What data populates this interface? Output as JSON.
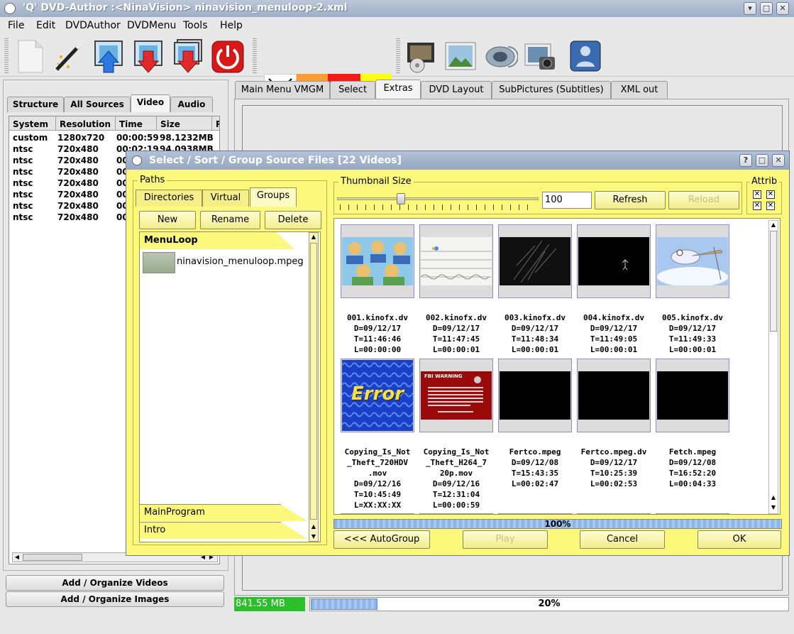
{
  "window": {
    "title": "'Q' DVD-Author :<NinaVision> ninavision_menuloop-2.xml"
  },
  "menu": [
    "File",
    "Edit",
    "DVDAuthor",
    "DVDMenu",
    "Tools",
    "Help"
  ],
  "toolbar_icons": [
    "new-document-icon",
    "magic-wand-icon",
    "import-icon",
    "export-icon",
    "export-all-icon",
    "power-icon",
    "no-color-icon",
    "orange-color",
    "red-color",
    "yellow-color",
    "video-film-icon",
    "image-icon",
    "audio-speaker-icon",
    "camera-icon",
    "user-folder-icon"
  ],
  "colors": {
    "orange": "#fb9d35",
    "red": "#f11a1a",
    "yellow": "#fdfd12",
    "dialog_bg": "#fbf87c",
    "size_green": "#2bc02b"
  },
  "left": {
    "tabs": [
      "Structure",
      "All Sources",
      "Video",
      "Audio"
    ],
    "active_tab": "Video",
    "columns": [
      "System",
      "Resolution",
      "Time",
      "Size",
      "R"
    ],
    "rows": [
      {
        "system": "custom",
        "resolution": "1280x720",
        "time": "00:00:59",
        "size": "98.1232MB"
      },
      {
        "system": "ntsc",
        "resolution": "720x480",
        "time": "00:02:19",
        "size": "94.0938MB"
      },
      {
        "system": "ntsc",
        "resolution": "720x480",
        "time": "00",
        "size": ""
      },
      {
        "system": "ntsc",
        "resolution": "720x480",
        "time": "00",
        "size": ""
      },
      {
        "system": "ntsc",
        "resolution": "720x480",
        "time": "00",
        "size": ""
      },
      {
        "system": "ntsc",
        "resolution": "720x480",
        "time": "00",
        "size": ""
      },
      {
        "system": "ntsc",
        "resolution": "720x480",
        "time": "00",
        "size": ""
      },
      {
        "system": "ntsc",
        "resolution": "720x480",
        "time": "00",
        "size": ""
      }
    ],
    "add_videos": "Add / Organize Videos",
    "add_images": "Add / Organize Images"
  },
  "main_tabs": [
    "Main Menu VMGM",
    "Select",
    "Extras",
    "DVD Layout",
    "SubPictures (Subtitles)",
    "XML out"
  ],
  "main_active_tab": "Extras",
  "status": {
    "size": "841.55 MB",
    "progress_label": "20%",
    "progress": 0.2
  },
  "dialog": {
    "title": "Select / Sort / Group Source Files [22 Videos]",
    "paths_label": "Paths",
    "path_tabs": [
      "Directories",
      "Virtual",
      "Groups"
    ],
    "active_path_tab": "Groups",
    "new": "New",
    "rename": "Rename",
    "delete": "Delete",
    "group_active": "MenuLoop",
    "group_file": "ninavision_menuloop.mpeg",
    "groups_other": [
      "MainProgram",
      "Intro"
    ],
    "thumb_label": "Thumbnail Size",
    "thumb_value": "100",
    "thumb_level": 100,
    "refresh": "Refresh",
    "reload": "Reload",
    "attrib_label": "Attrib",
    "thumbnails": [
      {
        "name": "001.kinofx.dv",
        "lines": [
          "001.kinofx.dv",
          "D=09/12/17",
          "T=11:46:46",
          "L=00:00:00"
        ],
        "kind": "cartoon"
      },
      {
        "name": "002.kinofx.dv",
        "lines": [
          "002.kinofx.dv",
          "D=09/12/17",
          "T=11:47:45",
          "L=00:00:01"
        ],
        "kind": "waves"
      },
      {
        "name": "003.kinofx.dv",
        "lines": [
          "003.kinofx.dv",
          "D=09/12/17",
          "T=11:48:34",
          "L=00:00:01"
        ],
        "kind": "dark"
      },
      {
        "name": "004.kinofx.dv",
        "lines": [
          "004.kinofx.dv",
          "D=09/12/17",
          "T=11:49:05",
          "L=00:00:01"
        ],
        "kind": "black-figure"
      },
      {
        "name": "005.kinofx.dv",
        "lines": [
          "005.kinofx.dv",
          "D=09/12/17",
          "T=11:49:33",
          "L=00:00:01"
        ],
        "kind": "bird"
      },
      {
        "name": "Copying_Is_Not_Theft_720HDV.mov",
        "lines": [
          "Copying_Is_Not",
          "_Theft_720HDV",
          ".mov",
          "D=09/12/16",
          "T=10:45:49",
          "L=XX:XX:XX"
        ],
        "kind": "error",
        "error_text": "Error"
      },
      {
        "name": "Copying_Is_Not_Theft_H264_720p.mov",
        "lines": [
          "Copying_Is_Not",
          "_Theft_H264_7",
          "20p.mov",
          "D=09/12/16",
          "T=12:31:04",
          "L=00:00:59"
        ],
        "kind": "fbi",
        "fbi_text": "FBI WARNING"
      },
      {
        "name": "Fertco.mpeg",
        "lines": [
          "Fertco.mpeg",
          "D=09/12/08",
          "T=15:43:35",
          "L=00:02:47"
        ],
        "kind": "black"
      },
      {
        "name": "Fertco.mpeg.dv",
        "lines": [
          "Fertco.mpeg.dv",
          "D=09/12/17",
          "T=10:25:39",
          "L=00:02:53"
        ],
        "kind": "black"
      },
      {
        "name": "Fetch.mpeg",
        "lines": [
          "Fetch.mpeg",
          "D=09/12/08",
          "T=16:52:20",
          "L=00:04:33"
        ],
        "kind": "black"
      }
    ],
    "progress_label": "100%",
    "progress": 1.0,
    "autogroup": "<<< AutoGroup",
    "play": "Play",
    "cancel": "Cancel",
    "ok": "OK"
  }
}
